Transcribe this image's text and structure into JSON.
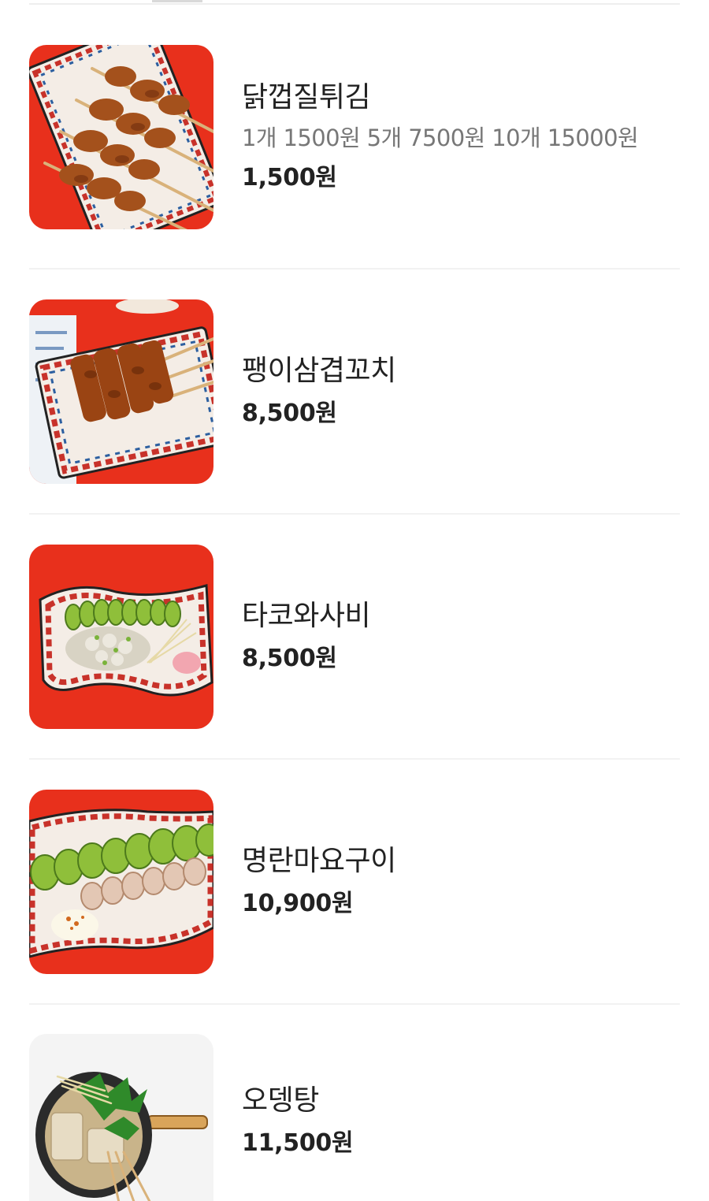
{
  "menu": {
    "items": [
      {
        "name": "닭껍질튀김",
        "description": "1개 1500원 5개 7500원 10개 15000원",
        "price": "1,500원",
        "image_icon": "chicken-skin-skewers-photo"
      },
      {
        "name": "팽이삼겹꼬치",
        "description": "",
        "price": "8,500원",
        "image_icon": "enoki-pork-belly-skewers-photo"
      },
      {
        "name": "타코와사비",
        "description": "",
        "price": "8,500원",
        "image_icon": "tako-wasabi-photo"
      },
      {
        "name": "명란마요구이",
        "description": "",
        "price": "10,900원",
        "image_icon": "grilled-pollock-roe-mayo-photo"
      },
      {
        "name": "오뎅탕",
        "description": "",
        "price": "11,500원",
        "image_icon": "fishcake-soup-photo"
      }
    ]
  },
  "colors": {
    "photo_red_background": "#e8301c",
    "plate_pattern_red": "#c8322a",
    "plate_pattern_blue": "#2c5fa0",
    "skewer_glaze": "#a4511c",
    "cucumber_green": "#8fbf3a",
    "divider": "#f2f2f2"
  }
}
